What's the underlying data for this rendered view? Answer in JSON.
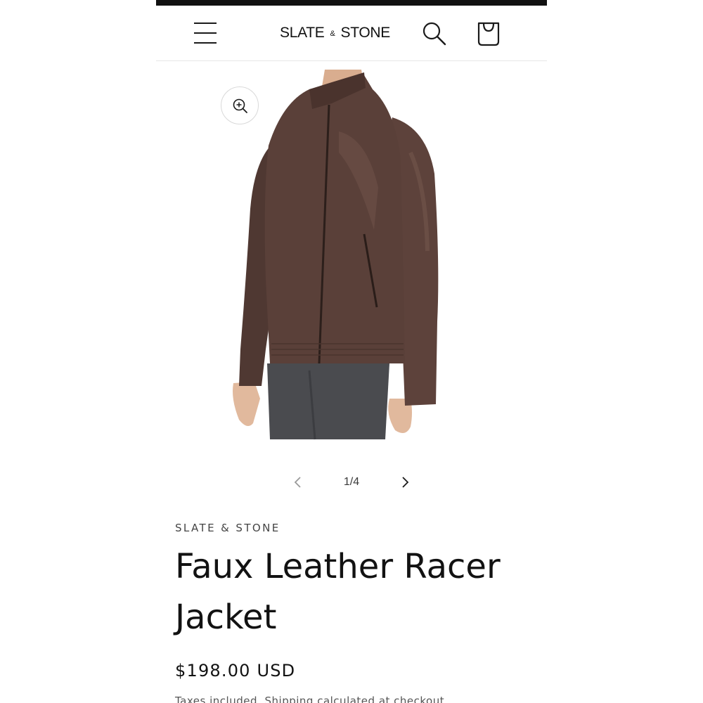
{
  "header": {
    "brand_left": "SLATE",
    "brand_amp": "&",
    "brand_right": "STONE",
    "icons": {
      "menu": "menu-icon",
      "search": "search-icon",
      "cart": "cart-icon"
    }
  },
  "gallery": {
    "zoom_icon": "zoom-in-icon",
    "current_slide": "1/4",
    "prev_icon": "chevron-left-icon",
    "next_icon": "chevron-right-icon",
    "image_subject": "brown faux leather racer jacket"
  },
  "product": {
    "vendor": "SLATE & STONE",
    "title": "Faux Leather Racer Jacket",
    "price": "$198.00 USD",
    "tax_note": "Taxes included. Shipping calculated at checkout."
  },
  "colors": {
    "text": "#121212",
    "topbar": "#111111",
    "jacket": "#5a4039",
    "jeans": "#4a4b4f"
  }
}
